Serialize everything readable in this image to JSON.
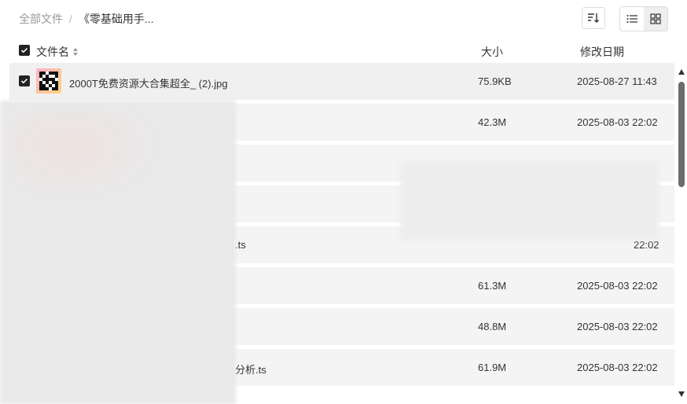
{
  "breadcrumb": {
    "root": "全部文件",
    "separator": "/",
    "current": "《零基础用手..."
  },
  "toolbar": {
    "sort_icon": "sort-icon",
    "list_view_icon": "list-view-icon",
    "grid_view_icon": "grid-view-icon"
  },
  "table": {
    "header": {
      "name": "文件名",
      "size": "大小",
      "date": "修改日期"
    },
    "rows": [
      {
        "name": "2000T免费资源大合集超全_ (2).jpg",
        "size": "75.9KB",
        "date": "2025-08-27 11:43",
        "selected": true
      },
      {
        "name": "",
        "size": "42.3M",
        "date": "2025-08-03 22:02"
      },
      {
        "name": "",
        "size": "",
        "date": ""
      },
      {
        "name": "",
        "size": "",
        "date": ""
      },
      {
        "name": ".ts",
        "size": "",
        "date": "22:02"
      },
      {
        "name": "",
        "size": "61.3M",
        "date": "2025-08-03 22:02"
      },
      {
        "name": "",
        "size": "48.8M",
        "date": "2025-08-03 22:02"
      },
      {
        "name": "分析.ts",
        "size": "61.9M",
        "date": "2025-08-03 22:02"
      }
    ]
  }
}
